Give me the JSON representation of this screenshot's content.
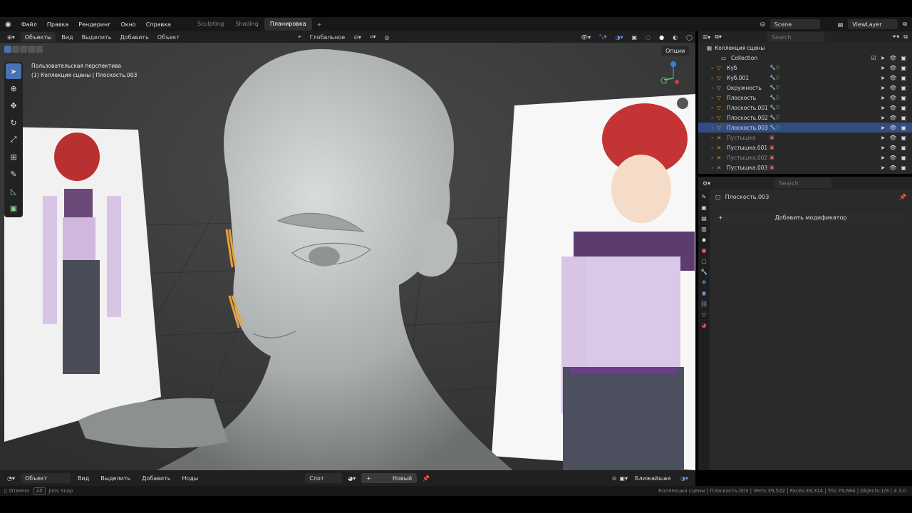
{
  "menu": {
    "file": "Файл",
    "edit": "Правка",
    "render": "Рендеринг",
    "window": "Окно",
    "help": "Справка"
  },
  "workspaces": [
    "Sculpting",
    "Shading",
    "Планировка"
  ],
  "active_workspace": 2,
  "scene": "Scene",
  "view_layer": "ViewLayer",
  "vp_header": {
    "mode": "Объекты",
    "view": "Вид",
    "select": "Выделить",
    "add": "Добавить",
    "object": "Объект",
    "orientation": "Глобальное",
    "options": "Опции"
  },
  "overlay": {
    "perspective": "Пользовательская перспектива",
    "collection": "(1) Коллекция сцены | Плоскость.003"
  },
  "outliner": {
    "search_placeholder": "Search",
    "scene_collection": "Коллекция сцены",
    "items": [
      {
        "name": "Collection",
        "kind": "collection"
      },
      {
        "name": "Куб",
        "kind": "mesh"
      },
      {
        "name": "Куб.001",
        "kind": "mesh"
      },
      {
        "name": "Окружность",
        "kind": "mesh"
      },
      {
        "name": "Плоскость",
        "kind": "mesh"
      },
      {
        "name": "Плоскость.001",
        "kind": "mesh"
      },
      {
        "name": "Плоскость.002",
        "kind": "mesh"
      },
      {
        "name": "Плоскость.003",
        "kind": "mesh",
        "selected": true
      },
      {
        "name": "Пустышка",
        "kind": "empty",
        "dim": true
      },
      {
        "name": "Пустышка.001",
        "kind": "empty"
      },
      {
        "name": "Пустышка.002",
        "kind": "empty",
        "dim": true
      },
      {
        "name": "Пустышка.003",
        "kind": "empty"
      }
    ]
  },
  "properties": {
    "search_placeholder": "Search",
    "object": "Плоскость.003",
    "add_modifier": "Добавить модификатор"
  },
  "footer": {
    "mode": "Объект",
    "view": "Вид",
    "select": "Выделить",
    "add": "Добавить",
    "nodes": "Ноды",
    "slot": "Слот",
    "new": "Новый",
    "snap": "Ближайшая"
  },
  "status": {
    "left1": "Отмена",
    "left2": "Alt",
    "left3": "Joos Snap",
    "right": "Коллекция сцены | Плоскость.003 | Verts:39,522 | Faces:39,314 | Tris:78,684 | Objects:1/9 | 4.3.0"
  },
  "colors": {
    "accent": "#4772b3",
    "selection": "#334d80",
    "mesh_icon": "#e8922f",
    "empty_icon": "#e06060"
  }
}
